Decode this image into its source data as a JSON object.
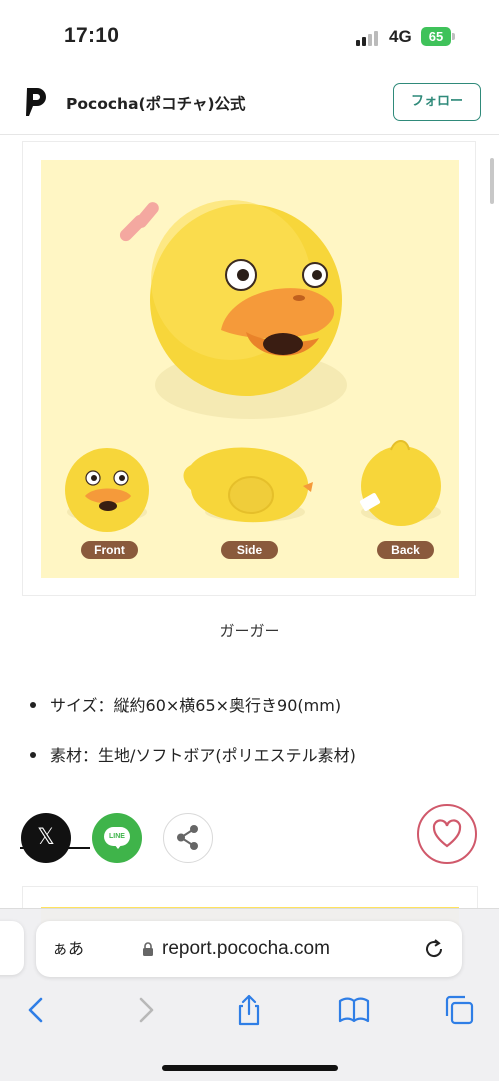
{
  "status_bar": {
    "time": "17:10",
    "network": "4G",
    "battery": "65"
  },
  "header": {
    "account_name": "Pococha(ポコチャ)公式",
    "follow_label": "フォロー",
    "logo_icon": "pococha-logo-icon"
  },
  "figure": {
    "labels": [
      "Front",
      "Side",
      "Back"
    ],
    "caption": "ガーガー",
    "background_color": "#fff6c4"
  },
  "specs": [
    "サイズ：縦約60×横65×奥行き90(mm)",
    "素材：生地/ソフトボア(ポリエステル素材)"
  ],
  "share": {
    "x_icon": "x-logo-icon",
    "line_label": "LINE",
    "share_icon": "share-icon",
    "like_icon": "heart-icon"
  },
  "safari": {
    "reader_label": "ぁあ",
    "url": "report.pococha.com",
    "toolbar_icons": [
      "back-icon",
      "forward-icon",
      "share-icon",
      "bookmarks-icon",
      "tabs-icon"
    ]
  },
  "colors": {
    "accent": "#2f8a7a",
    "like": "#d0596b",
    "line_green": "#3fb44a"
  }
}
